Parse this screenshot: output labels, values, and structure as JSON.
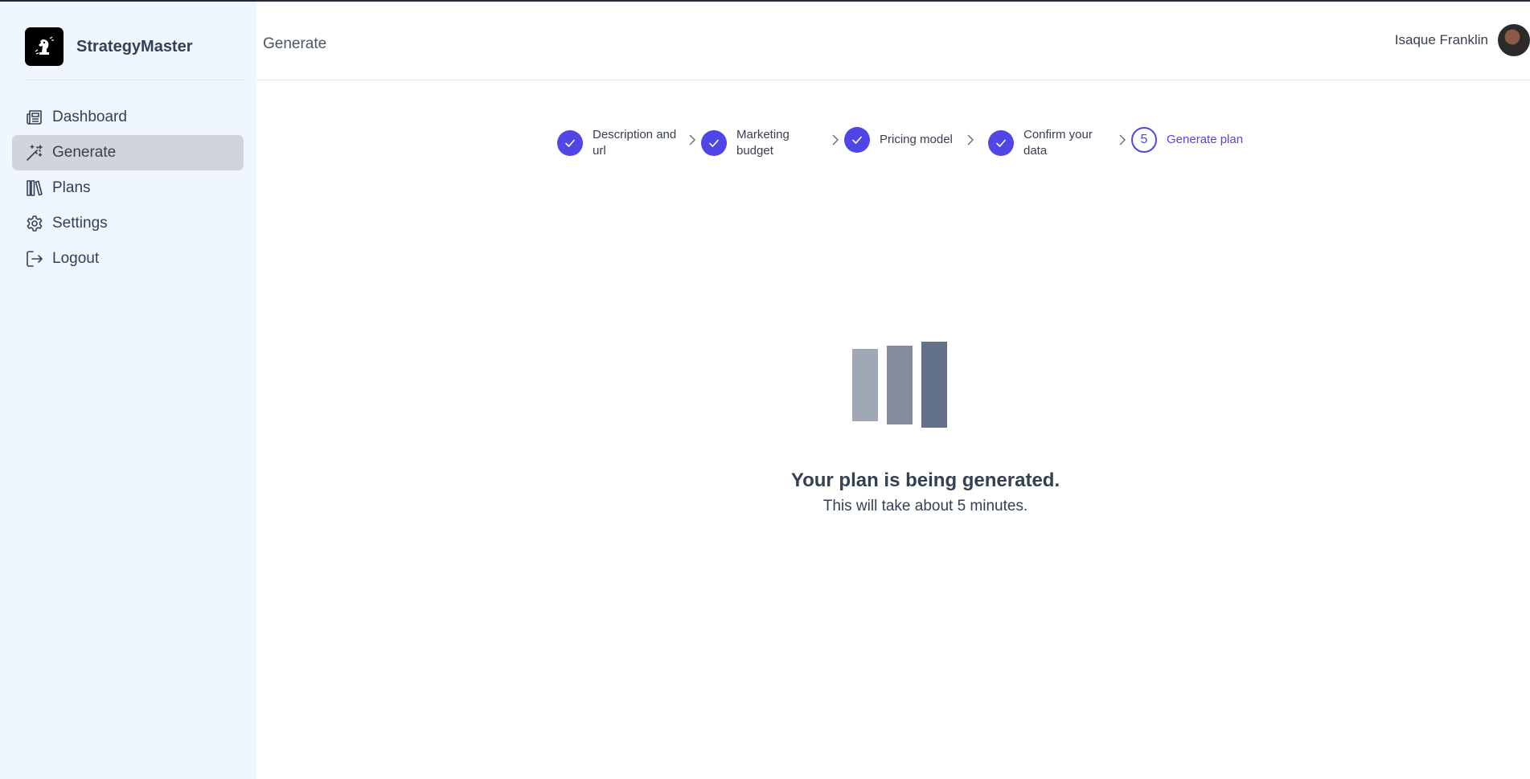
{
  "sidebar": {
    "brand_name": "StrategyMaster",
    "items": [
      {
        "label": "Dashboard",
        "icon": "newspaper-icon"
      },
      {
        "label": "Generate",
        "icon": "magic-wand-icon",
        "active": true
      },
      {
        "label": "Plans",
        "icon": "books-icon"
      },
      {
        "label": "Settings",
        "icon": "gear-icon"
      },
      {
        "label": "Logout",
        "icon": "logout-icon"
      }
    ]
  },
  "header": {
    "title": "Generate",
    "user_name": "Isaque Franklin"
  },
  "stepper": {
    "steps": [
      {
        "label": "Description and url",
        "status": "complete"
      },
      {
        "label": "Marketing budget",
        "status": "complete"
      },
      {
        "label": "Pricing model",
        "status": "complete"
      },
      {
        "label": "Confirm your data",
        "status": "complete"
      },
      {
        "label": "Generate plan",
        "number": "5",
        "status": "current"
      }
    ]
  },
  "status": {
    "title": "Your plan is being generated.",
    "subtitle": "This will take about 5 minutes."
  },
  "colors": {
    "accent": "#4f46e5",
    "sidebar_bg": "#eff6ff",
    "active_item_bg": "#d1d5db",
    "loader_bars": [
      "#a1a8b5",
      "#838c9c",
      "#637189"
    ]
  }
}
